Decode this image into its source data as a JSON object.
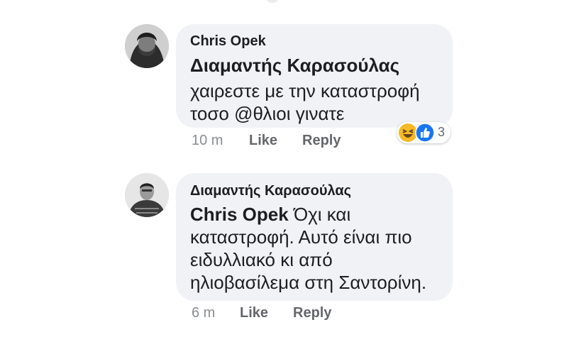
{
  "comments": [
    {
      "author": "Chris Opek",
      "mention": "Διαμαντής Καρασούλας",
      "lines": [
        "χαιρεστε με την καταστροφή",
        "τοσο @θλιοι γινατε"
      ],
      "time": "10 m",
      "like_label": "Like",
      "reply_label": "Reply",
      "reactions": {
        "icons": [
          "haha-icon",
          "like-icon"
        ],
        "count": "3"
      }
    },
    {
      "author": "Διαμαντής Καρασούλας",
      "mention": "Chris Opek",
      "lines": [
        " Όχι και",
        "καταστροφή. Αυτό είναι πιο",
        "ειδυλλιακό κι από",
        "ηλιοβασίλεμα στη Σαντορίνη."
      ],
      "time": "6 m",
      "like_label": "Like",
      "reply_label": "Reply"
    }
  ],
  "colors": {
    "bubble": "#f0f2f5",
    "text": "#1c1e21",
    "meta": "#65676b",
    "like_blue": "#1877f2",
    "haha_yellow": "#f7b928"
  }
}
